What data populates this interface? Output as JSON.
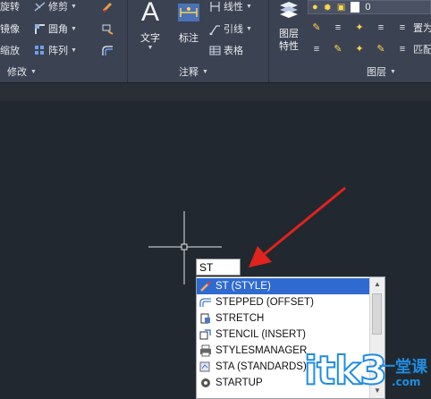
{
  "ribbon": {
    "modify": {
      "items": [
        {
          "label": "旋转",
          "icon": "rotate-icon"
        },
        {
          "label": "修剪",
          "icon": "trim-icon"
        },
        {
          "label": "镜像",
          "icon": "mirror-icon"
        },
        {
          "label": "圆角",
          "icon": "fillet-icon"
        },
        {
          "label": "缩放",
          "icon": "scale-icon"
        },
        {
          "label": "阵列",
          "icon": "array-icon"
        }
      ],
      "panel_label": "修改"
    },
    "annotation": {
      "text_label": "文字",
      "dim_label": "标注",
      "linear_label": "线性",
      "leader_label": "引线",
      "table_label": "表格",
      "panel_label": "注释"
    },
    "layers": {
      "layer_props_label": "图层\n特性",
      "layer_props_line1": "图层",
      "layer_props_line2": "特性",
      "layer_value": "0",
      "set_current_label": "置为",
      "match_label": "匹配",
      "panel_label": "图层"
    }
  },
  "command": {
    "input_value": "ST"
  },
  "autocomplete": {
    "items": [
      {
        "label": "ST (STYLE)",
        "icon": "style-brush-icon",
        "selected": true
      },
      {
        "label": "STEPPED (OFFSET)",
        "icon": "offset-icon",
        "selected": false
      },
      {
        "label": "STRETCH",
        "icon": "stretch-icon",
        "selected": false
      },
      {
        "label": "STENCIL (INSERT)",
        "icon": "insert-icon",
        "selected": false
      },
      {
        "label": "STYLESMANAGER",
        "icon": "printer-icon",
        "selected": false
      },
      {
        "label": "STA (STANDARDS)",
        "icon": "standards-icon",
        "selected": false
      },
      {
        "label": "STARTUP",
        "icon": "gear-icon",
        "selected": false
      }
    ]
  },
  "watermark": {
    "latin": "itk3",
    "dotcom": ".com",
    "cjk": "一堂课"
  },
  "colors": {
    "ribbon_bg": "#3b4252",
    "canvas_bg": "#212830",
    "selection": "#2f6ad0",
    "arrow": "#e0231c",
    "watermark_blue": "#1f8de0"
  }
}
